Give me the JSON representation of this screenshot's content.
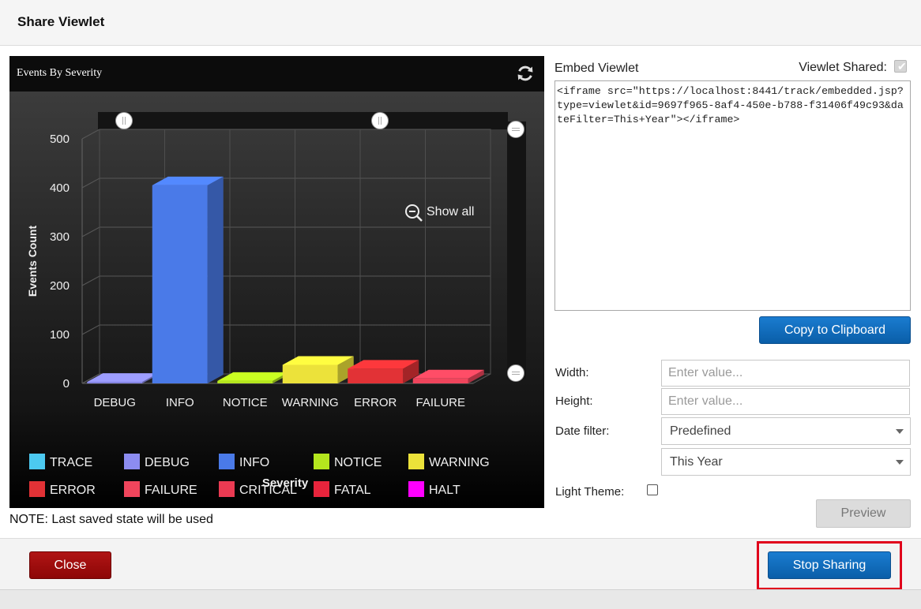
{
  "dialog": {
    "title": "Share Viewlet"
  },
  "chart_panel": {
    "title": "Events By Severity",
    "refresh_icon": "refresh-icon"
  },
  "chart_data": {
    "type": "bar",
    "title": "Events By Severity",
    "xlabel": "Severity",
    "ylabel": "Events Count",
    "ylim": [
      0,
      500
    ],
    "yticks": [
      0,
      100,
      200,
      300,
      400,
      500
    ],
    "categories": [
      "DEBUG",
      "INFO",
      "NOTICE",
      "WARNING",
      "ERROR",
      "FAILURE"
    ],
    "values": [
      3,
      405,
      5,
      38,
      30,
      10
    ],
    "bar_colors": [
      "#8c8cf0",
      "#4a7ae8",
      "#b4e61e",
      "#ece23a",
      "#e23236",
      "#f0455c"
    ],
    "zoom_label": "Show all",
    "legend": [
      {
        "name": "TRACE",
        "color": "#4cc9f0"
      },
      {
        "name": "DEBUG",
        "color": "#8c8cf0"
      },
      {
        "name": "INFO",
        "color": "#4a7ae8"
      },
      {
        "name": "NOTICE",
        "color": "#b4e61e"
      },
      {
        "name": "WARNING",
        "color": "#ece23a"
      },
      {
        "name": "ERROR",
        "color": "#e23236"
      },
      {
        "name": "FAILURE",
        "color": "#f0455c"
      },
      {
        "name": "CRITICAL",
        "color": "#ea3a52"
      },
      {
        "name": "FATAL",
        "color": "#e8243c"
      },
      {
        "name": "HALT",
        "color": "#ff00ff"
      }
    ],
    "legend_position": "bottom",
    "grid": true
  },
  "note": "NOTE: Last saved state will be used",
  "embed": {
    "label": "Embed Viewlet",
    "shared_label": "Viewlet Shared:",
    "shared_checked": true,
    "code": "<iframe src=\"https://localhost:8441/track/embedded.jsp?type=viewlet&id=9697f965-8af4-450e-b788-f31406f49c93&dateFilter=This+Year\"></iframe>",
    "copy_label": "Copy to Clipboard"
  },
  "form": {
    "width_label": "Width:",
    "width_placeholder": "Enter value...",
    "height_label": "Height:",
    "height_placeholder": "Enter value...",
    "date_filter_label": "Date filter:",
    "date_filter_value": "Predefined",
    "date_range_value": "This Year",
    "light_theme_label": "Light Theme:",
    "light_theme_checked": false,
    "preview_label": "Preview"
  },
  "footer": {
    "close_label": "Close",
    "stop_label": "Stop Sharing"
  }
}
